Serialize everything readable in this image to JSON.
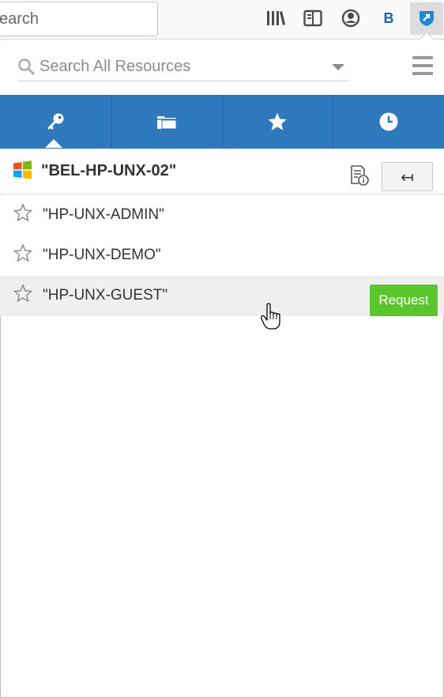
{
  "browser": {
    "url_text": "earch",
    "icons": [
      "library-icon",
      "sidebar-icon",
      "account-icon",
      "bold-b-icon",
      "extension-shield-icon"
    ],
    "bold_icon_text": "B"
  },
  "search": {
    "placeholder": "Search All Resources"
  },
  "tabs": [
    {
      "icon": "key-icon",
      "active": true
    },
    {
      "icon": "folder-icon",
      "active": false
    },
    {
      "icon": "star-icon",
      "active": false
    },
    {
      "icon": "clock-icon",
      "active": false
    }
  ],
  "resource": {
    "title": "\"BEL-HP-UNX-02\"",
    "back_symbol": "↤"
  },
  "accounts": [
    {
      "label": "\"HP-UNX-ADMIN\""
    },
    {
      "label": "\"HP-UNX-DEMO\""
    },
    {
      "label": "\"HP-UNX-GUEST\"",
      "hover": true,
      "action": "Request"
    }
  ],
  "colors": {
    "tab_bar": "#2e78bd",
    "request_button": "#5ac52c",
    "hover_row": "#efefef"
  }
}
